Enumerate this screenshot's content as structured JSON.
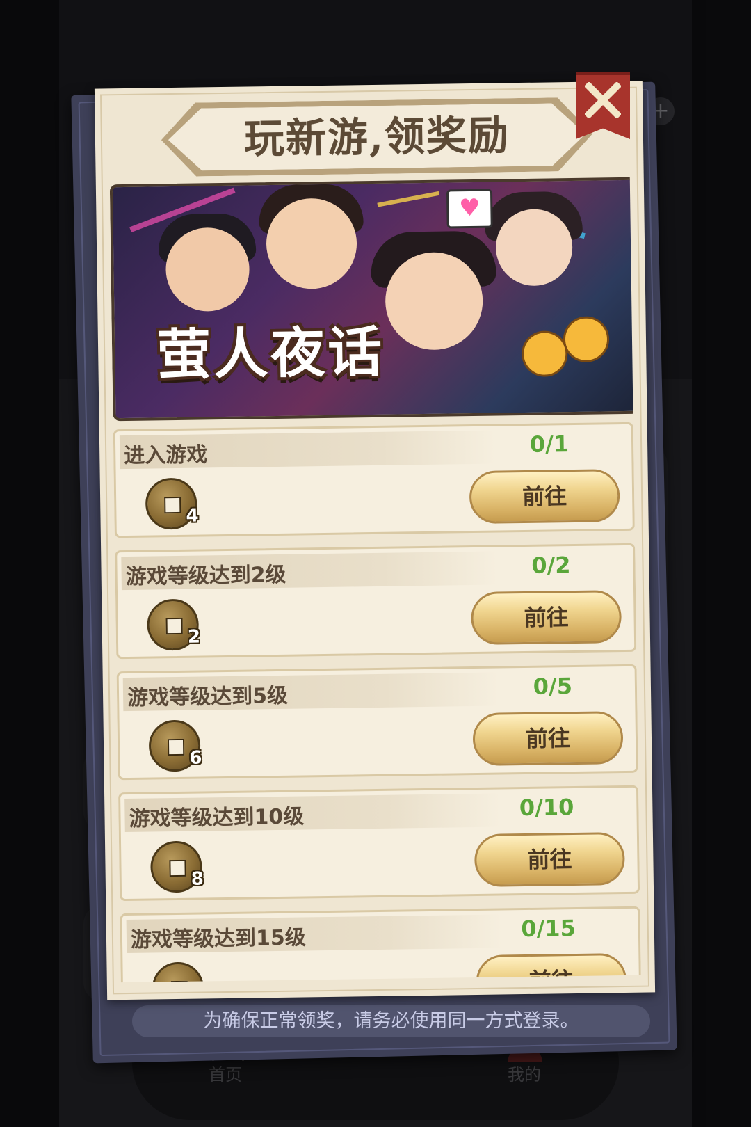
{
  "modal": {
    "title": "玩新游,领奖励",
    "game_logo": "萤人夜话",
    "notice": "为确保正常领奖，请务必使用同一方式登录。",
    "button_label": "前往",
    "tasks": [
      {
        "name": "进入游戏",
        "progress": "0/1",
        "reward": "4"
      },
      {
        "name": "游戏等级达到2级",
        "progress": "0/2",
        "reward": "2"
      },
      {
        "name": "游戏等级达到5级",
        "progress": "0/5",
        "reward": "6"
      },
      {
        "name": "游戏等级达到10级",
        "progress": "0/10",
        "reward": "8"
      },
      {
        "name": "游戏等级达到15级",
        "progress": "0/15",
        "reward": ""
      }
    ]
  },
  "background": {
    "tab_home": "首页",
    "tab_mine": "我的"
  },
  "colors": {
    "progress": "#5aa63a",
    "close_button": "#a8342c",
    "paper": "#efe6d2"
  }
}
